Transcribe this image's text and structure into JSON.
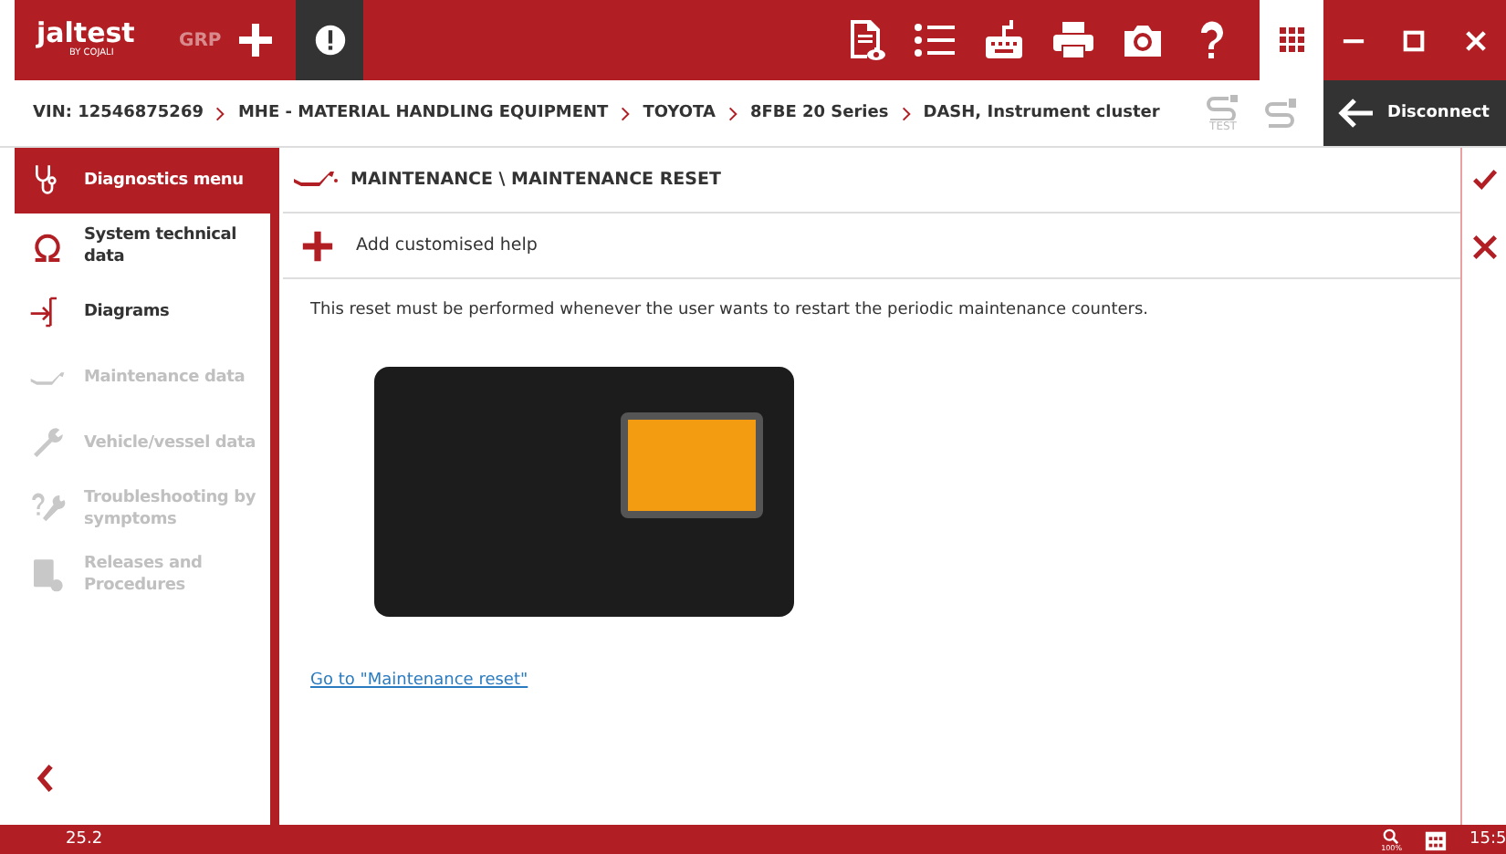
{
  "header": {
    "brand": "jaltest",
    "brand_sub": "BY COJALI",
    "group": "GRP"
  },
  "breadcrumb": [
    "VIN: 12546875269",
    "MHE - MATERIAL HANDLING EQUIPMENT",
    "TOYOTA",
    "8FBE 20 Series",
    "DASH, Instrument cluster"
  ],
  "test_label": "TEST",
  "disconnect": "Disconnect",
  "sidebar": {
    "items": [
      {
        "label": "Diagnostics menu",
        "kind": "stethoscope",
        "selected": true,
        "disabled": false
      },
      {
        "label": "System technical data",
        "kind": "omega",
        "selected": false,
        "disabled": false
      },
      {
        "label": "Diagrams",
        "kind": "diagram",
        "selected": false,
        "disabled": false
      },
      {
        "label": "Maintenance data",
        "kind": "oilcan",
        "selected": false,
        "disabled": true
      },
      {
        "label": "Vehicle/vessel data",
        "kind": "wrench",
        "selected": false,
        "disabled": true
      },
      {
        "label": "Troubleshooting by symptoms",
        "kind": "question",
        "selected": false,
        "disabled": true
      },
      {
        "label": "Releases and Procedures",
        "kind": "document",
        "selected": false,
        "disabled": true
      }
    ]
  },
  "content": {
    "title": "MAINTENANCE \\ MAINTENANCE RESET",
    "add_help": "Add customised help",
    "description": "This reset must be performed whenever the user wants to restart the periodic maintenance counters.",
    "link": "Go to \"Maintenance reset\""
  },
  "status_bar": {
    "version": "25.2",
    "zoom": "100%",
    "time": "15:5"
  }
}
